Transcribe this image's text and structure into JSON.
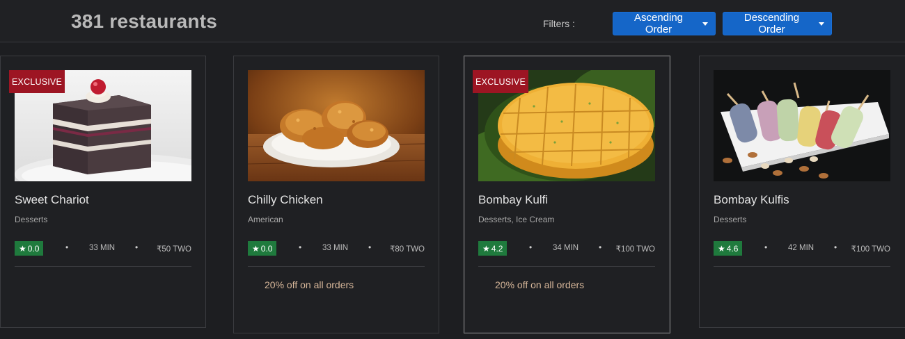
{
  "header": {
    "count_title": "381 restaurants",
    "filters_label": "Filters :",
    "ascending_label": "Ascending Order",
    "descending_label": "Descending Order"
  },
  "colors": {
    "primary_button": "#1566c8",
    "exclusive_badge": "#9d1523",
    "rating_badge": "#1f7a3d",
    "offer_text": "#d7b79a"
  },
  "restaurants": [
    {
      "badge": "EXCLUSIVE",
      "image": "black-forest-cake-image",
      "name": "Sweet Chariot",
      "cuisine": "Desserts",
      "rating": "0.0",
      "time": "33 MIN",
      "price": "₹50 TWO",
      "offer": ""
    },
    {
      "badge": "",
      "image": "fried-chicken-image",
      "name": "Chilly Chicken",
      "cuisine": "American",
      "rating": "0.0",
      "time": "33 MIN",
      "price": "₹80 TWO",
      "offer": "20% off on all orders"
    },
    {
      "badge": "EXCLUSIVE",
      "image": "mango-burfi-image",
      "name": "Bombay Kulfi",
      "cuisine": "Desserts, Ice Cream",
      "rating": "4.2",
      "time": "34 MIN",
      "price": "₹100 TWO",
      "offer": "20% off on all orders"
    },
    {
      "badge": "",
      "image": "kulfi-popsicles-image",
      "name": "Bombay Kulfis",
      "cuisine": "Desserts",
      "rating": "4.6",
      "time": "42 MIN",
      "price": "₹100 TWO",
      "offer": ""
    }
  ]
}
